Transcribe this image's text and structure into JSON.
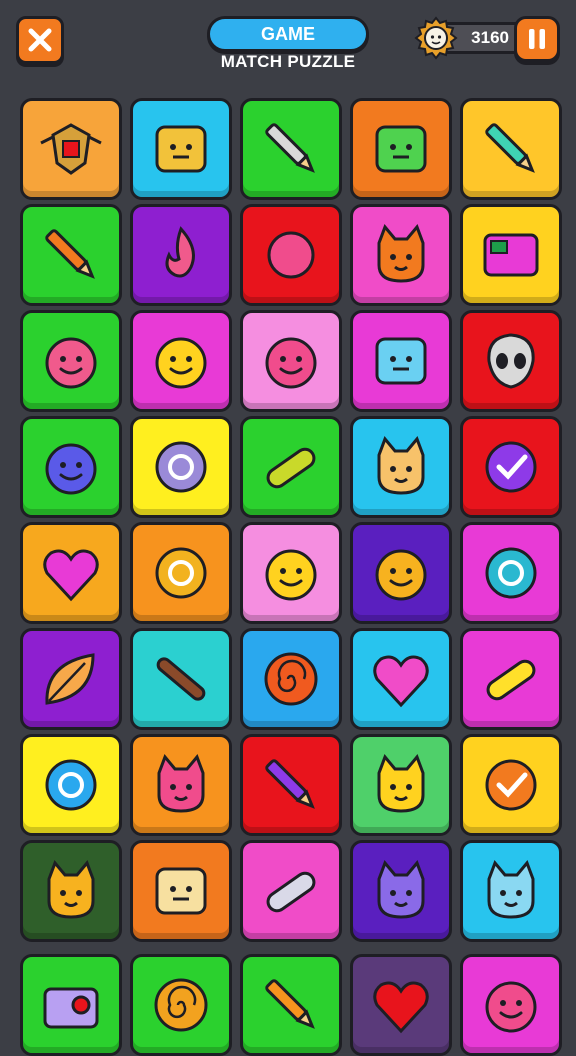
{
  "header": {
    "title": "GAME",
    "subtitle": "MATCH PUZZLE",
    "coins": "3160"
  },
  "colors": {
    "orange": "#f7931e",
    "cyan": "#28c4ee",
    "green": "#2bd12e",
    "yellow": "#ffd21f",
    "purple": "#8e1fd0",
    "red": "#e8141c",
    "magenta": "#e83ad6",
    "pink": "#f58ee0",
    "teal": "#2bd0d0",
    "blue": "#2aa8ee",
    "darkgreen": "#2f5f2a",
    "indigo": "#5a1fbf",
    "darkpurple": "#5a3a7a"
  },
  "tiles": [
    {
      "color": "#f7a43a",
      "icon": "eagle-crest-icon"
    },
    {
      "color": "#28c4ee",
      "icon": "golden-mask-icon"
    },
    {
      "color": "#2bd12e",
      "icon": "sword-leaf-icon"
    },
    {
      "color": "#f27a1f",
      "icon": "green-smile-icon"
    },
    {
      "color": "#ffc62a",
      "icon": "rocket-pen-icon"
    },
    {
      "color": "#2bd12e",
      "icon": "laurel-pen-icon"
    },
    {
      "color": "#8e1fd0",
      "icon": "flame-laurel-icon"
    },
    {
      "color": "#e8141c",
      "icon": "sun-heart-icon"
    },
    {
      "color": "#f04cc8",
      "icon": "cat-pair-icon"
    },
    {
      "color": "#ffd21f",
      "icon": "gadget-board-icon"
    },
    {
      "color": "#2bd12e",
      "icon": "plug-creature-icon"
    },
    {
      "color": "#e83ad6",
      "icon": "yellow-blob-icon"
    },
    {
      "color": "#f58ee0",
      "icon": "pink-urchin-icon"
    },
    {
      "color": "#e83ad6",
      "icon": "blue-robot-icon"
    },
    {
      "color": "#e8141c",
      "icon": "alien-face-icon"
    },
    {
      "color": "#2bd12e",
      "icon": "blue-blob-icon"
    },
    {
      "color": "#ffef1f",
      "icon": "bottle-bubble-icon"
    },
    {
      "color": "#2bd12e",
      "icon": "capsule-icon"
    },
    {
      "color": "#28c4ee",
      "icon": "fox-face-icon"
    },
    {
      "color": "#e8141c",
      "icon": "purple-check-icon"
    },
    {
      "color": "#f7a81e",
      "icon": "pink-heart-icon"
    },
    {
      "color": "#f7931e",
      "icon": "gold-coin-icon"
    },
    {
      "color": "#f58ee0",
      "icon": "wink-blob-icon"
    },
    {
      "color": "#5a1fbf",
      "icon": "sun-face-icon"
    },
    {
      "color": "#e83ad6",
      "icon": "target-orb-icon"
    },
    {
      "color": "#8e1fd0",
      "icon": "leaf-icon"
    },
    {
      "color": "#2bd0d0",
      "icon": "stick-icon"
    },
    {
      "color": "#2aa8ee",
      "icon": "orange-swirl-icon"
    },
    {
      "color": "#28c4ee",
      "icon": "heart-bowl-icon"
    },
    {
      "color": "#e83ad6",
      "icon": "yellow-bar-icon"
    },
    {
      "color": "#ffef1f",
      "icon": "blue-hook-icon"
    },
    {
      "color": "#f7931e",
      "icon": "pink-cat-icon"
    },
    {
      "color": "#e8141c",
      "icon": "purple-pen-icon"
    },
    {
      "color": "#4fd06a",
      "icon": "yellow-fox-icon"
    },
    {
      "color": "#ffd21f",
      "icon": "orange-check-icon"
    },
    {
      "color": "#2f5f2a",
      "icon": "sleepy-cat-icon"
    },
    {
      "color": "#f27a1f",
      "icon": "barrel-face-icon"
    },
    {
      "color": "#f04cc8",
      "icon": "safety-pin-icon"
    },
    {
      "color": "#5a1fbf",
      "icon": "purple-cat-icon"
    },
    {
      "color": "#28c4ee",
      "icon": "blue-cat-icon"
    },
    {
      "color": "#2bd12e",
      "icon": "camera-box-icon"
    },
    {
      "color": "#2bd12e",
      "icon": "spiral-icon"
    },
    {
      "color": "#2bd12e",
      "icon": "sun-pencil-icon"
    },
    {
      "color": "#5a3a7a",
      "icon": "red-heart-icon"
    },
    {
      "color": "#e83ad6",
      "icon": "pink-spiky-icon"
    }
  ]
}
